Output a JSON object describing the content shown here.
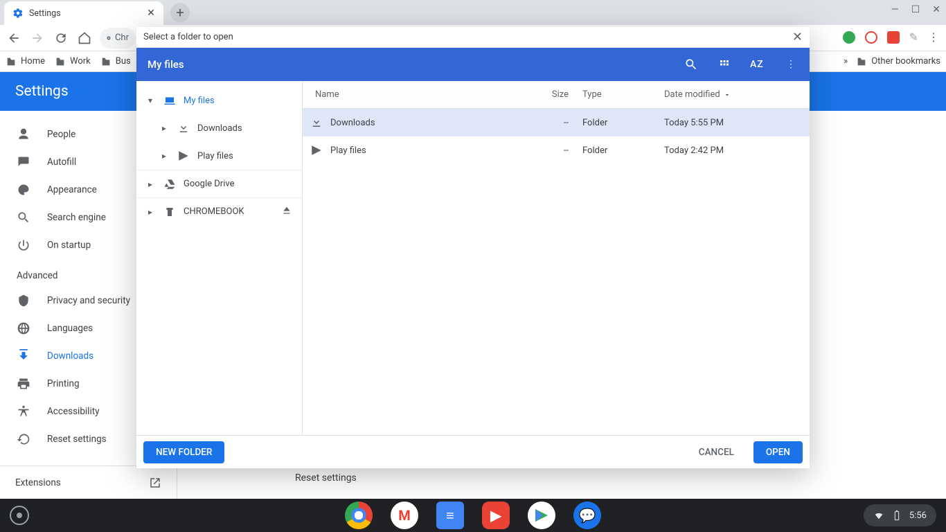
{
  "browser": {
    "tab_title": "Settings",
    "address_fragment": "Chr"
  },
  "bookmarks": {
    "items": [
      "Home",
      "Work",
      "Bus"
    ],
    "overflow": "»",
    "other": "Other bookmarks"
  },
  "settings": {
    "header": "Settings",
    "advanced_label": "Advanced",
    "items_basic": [
      {
        "label": "People"
      },
      {
        "label": "Autofill"
      },
      {
        "label": "Appearance"
      },
      {
        "label": "Search engine"
      },
      {
        "label": "On startup"
      }
    ],
    "items_advanced": [
      {
        "label": "Privacy and security"
      },
      {
        "label": "Languages"
      },
      {
        "label": "Downloads",
        "active": true
      },
      {
        "label": "Printing"
      },
      {
        "label": "Accessibility"
      },
      {
        "label": "Reset settings"
      }
    ],
    "extensions": "Extensions",
    "content_heading": "Reset settings"
  },
  "dialog": {
    "title": "Select a folder to open",
    "header": "My files",
    "nav": {
      "my_files": "My files",
      "downloads": "Downloads",
      "play_files": "Play files",
      "google_drive": "Google Drive",
      "chromebook": "CHROMEBOOK"
    },
    "columns": {
      "name": "Name",
      "size": "Size",
      "type": "Type",
      "date": "Date modified"
    },
    "rows": [
      {
        "name": "Downloads",
        "size": "--",
        "type": "Folder",
        "date": "Today 5:55 PM",
        "icon": "download",
        "selected": true
      },
      {
        "name": "Play files",
        "size": "--",
        "type": "Folder",
        "date": "Today 2:42 PM",
        "icon": "play",
        "selected": false
      }
    ],
    "sort_label": "AZ",
    "footer": {
      "new_folder": "NEW FOLDER",
      "cancel": "CANCEL",
      "open": "OPEN"
    }
  },
  "shelf": {
    "clock": "5:56"
  }
}
